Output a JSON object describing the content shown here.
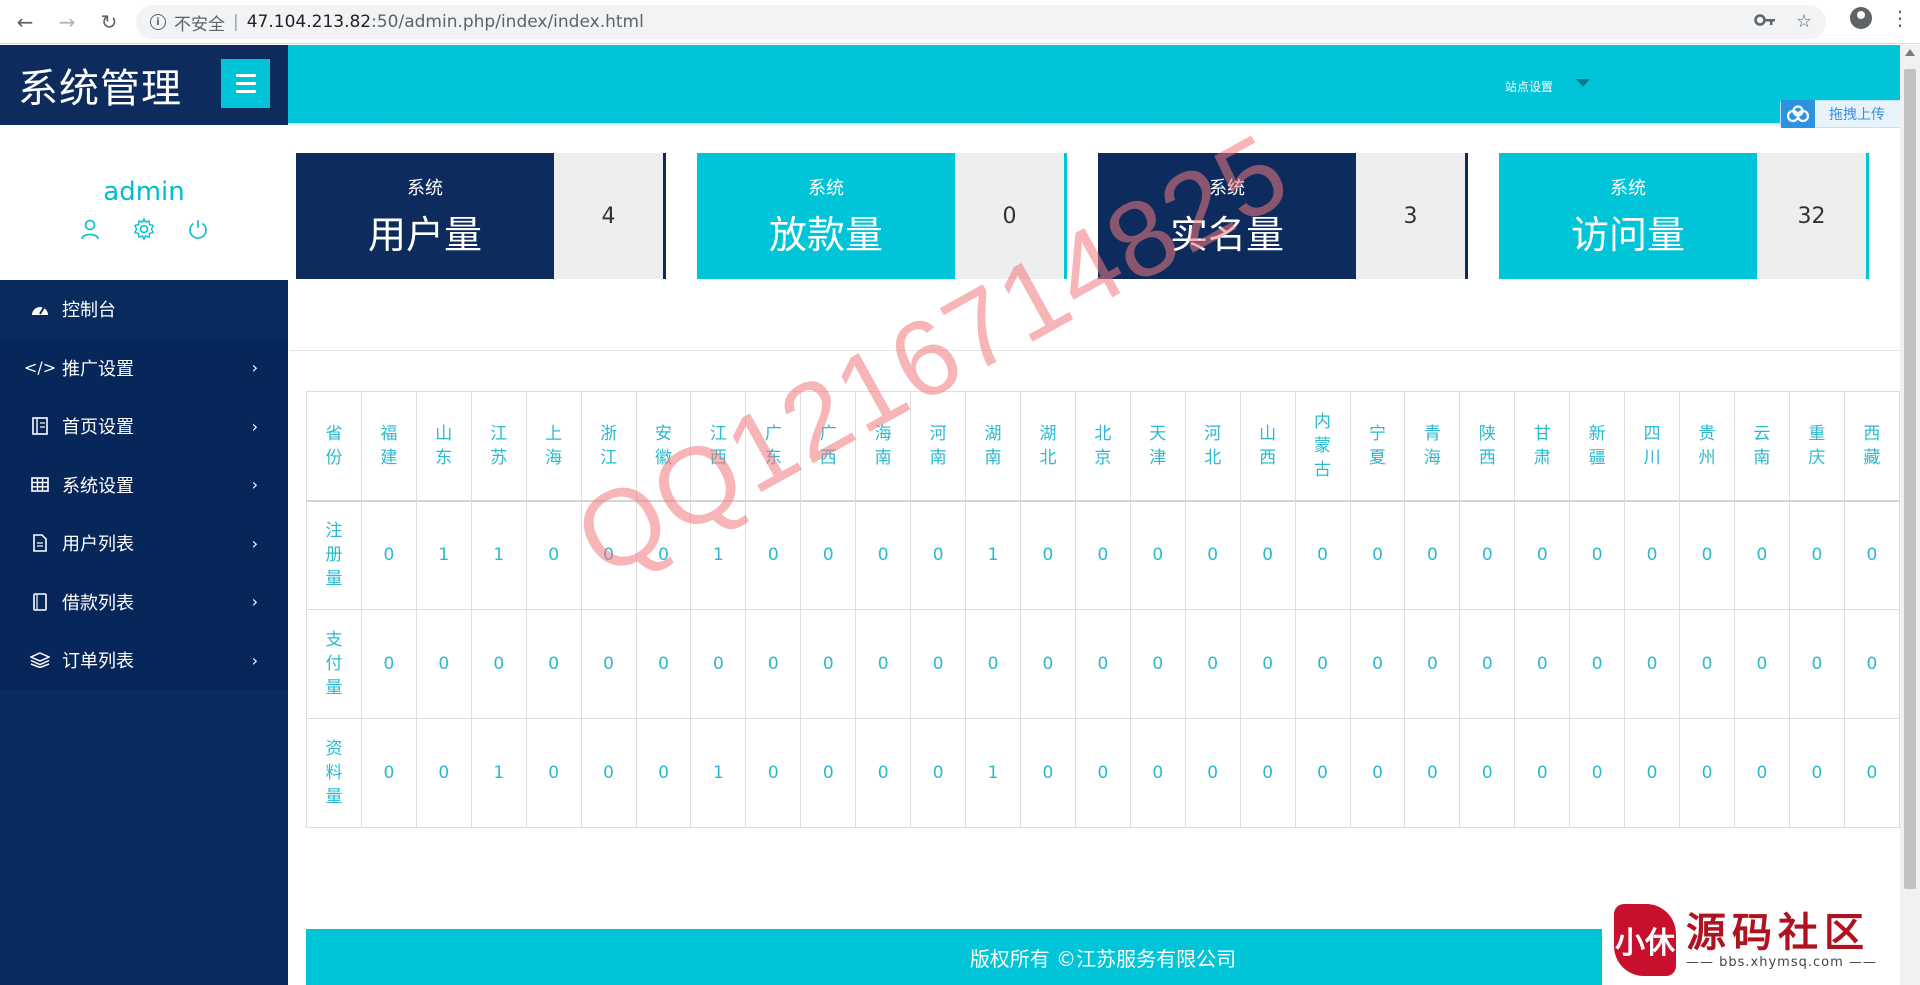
{
  "browser": {
    "security_label": "不安全",
    "url_host": "47.104.213.82",
    "url_rest": ":50/admin.php/index/index.html"
  },
  "sidebar": {
    "brand_title": "系统管理",
    "user_name": "admin",
    "items": [
      {
        "label": "控制台",
        "icon": "dashboard-icon",
        "has_children": false
      },
      {
        "label": "推广设置",
        "icon": "code-icon",
        "has_children": true
      },
      {
        "label": "首页设置",
        "icon": "book-icon",
        "has_children": true
      },
      {
        "label": "系统设置",
        "icon": "grid-icon",
        "has_children": true
      },
      {
        "label": "用户列表",
        "icon": "file-icon",
        "has_children": true
      },
      {
        "label": "借款列表",
        "icon": "notebook-icon",
        "has_children": true
      },
      {
        "label": "订单列表",
        "icon": "layers-icon",
        "has_children": true
      }
    ]
  },
  "topbar": {
    "site_settings_label": "站点设置"
  },
  "upload_widget": {
    "label": "拖拽上传"
  },
  "stats": [
    {
      "sub": "系统",
      "label": "用户量",
      "value": "4",
      "theme": "dark"
    },
    {
      "sub": "系统",
      "label": "放款量",
      "value": "0",
      "theme": "teal"
    },
    {
      "sub": "系统",
      "label": "实名量",
      "value": "3",
      "theme": "dark"
    },
    {
      "sub": "系统",
      "label": "访问量",
      "value": "32",
      "theme": "teal"
    }
  ],
  "province_table": {
    "header_label": "省份",
    "provinces": [
      "福建",
      "山东",
      "江苏",
      "上海",
      "浙江",
      "安徽",
      "江西",
      "广东",
      "广西",
      "海南",
      "河南",
      "湖南",
      "湖北",
      "北京",
      "天津",
      "河北",
      "山西",
      "内蒙古",
      "宁夏",
      "青海",
      "陕西",
      "甘肃",
      "新疆",
      "四川",
      "贵州",
      "云南",
      "重庆",
      "西藏"
    ],
    "rows": [
      {
        "label": "注册量",
        "values": [
          "0",
          "1",
          "1",
          "0",
          "0",
          "0",
          "1",
          "0",
          "0",
          "0",
          "0",
          "1",
          "0",
          "0",
          "0",
          "0",
          "0",
          "0",
          "0",
          "0",
          "0",
          "0",
          "0",
          "0",
          "0",
          "0",
          "0",
          "0"
        ]
      },
      {
        "label": "支付量",
        "values": [
          "0",
          "0",
          "0",
          "0",
          "0",
          "0",
          "0",
          "0",
          "0",
          "0",
          "0",
          "0",
          "0",
          "0",
          "0",
          "0",
          "0",
          "0",
          "0",
          "0",
          "0",
          "0",
          "0",
          "0",
          "0",
          "0",
          "0",
          "0"
        ]
      },
      {
        "label": "资料量",
        "values": [
          "0",
          "0",
          "1",
          "0",
          "0",
          "0",
          "1",
          "0",
          "0",
          "0",
          "0",
          "1",
          "0",
          "0",
          "0",
          "0",
          "0",
          "0",
          "0",
          "0",
          "0",
          "0",
          "0",
          "0",
          "0",
          "0",
          "0",
          "0"
        ]
      }
    ]
  },
  "watermark": "QQ1216714825",
  "footer": {
    "copyright": "版权所有 ©江苏服务有限公司"
  },
  "forum_logo": {
    "seal_text": "小休",
    "title": "源码社区",
    "url": "—— bbs.xhymsq.com ——"
  },
  "colors": {
    "navy": "#0d2c5d",
    "teal": "#00c5d8",
    "table_text": "#2ab9cf"
  }
}
